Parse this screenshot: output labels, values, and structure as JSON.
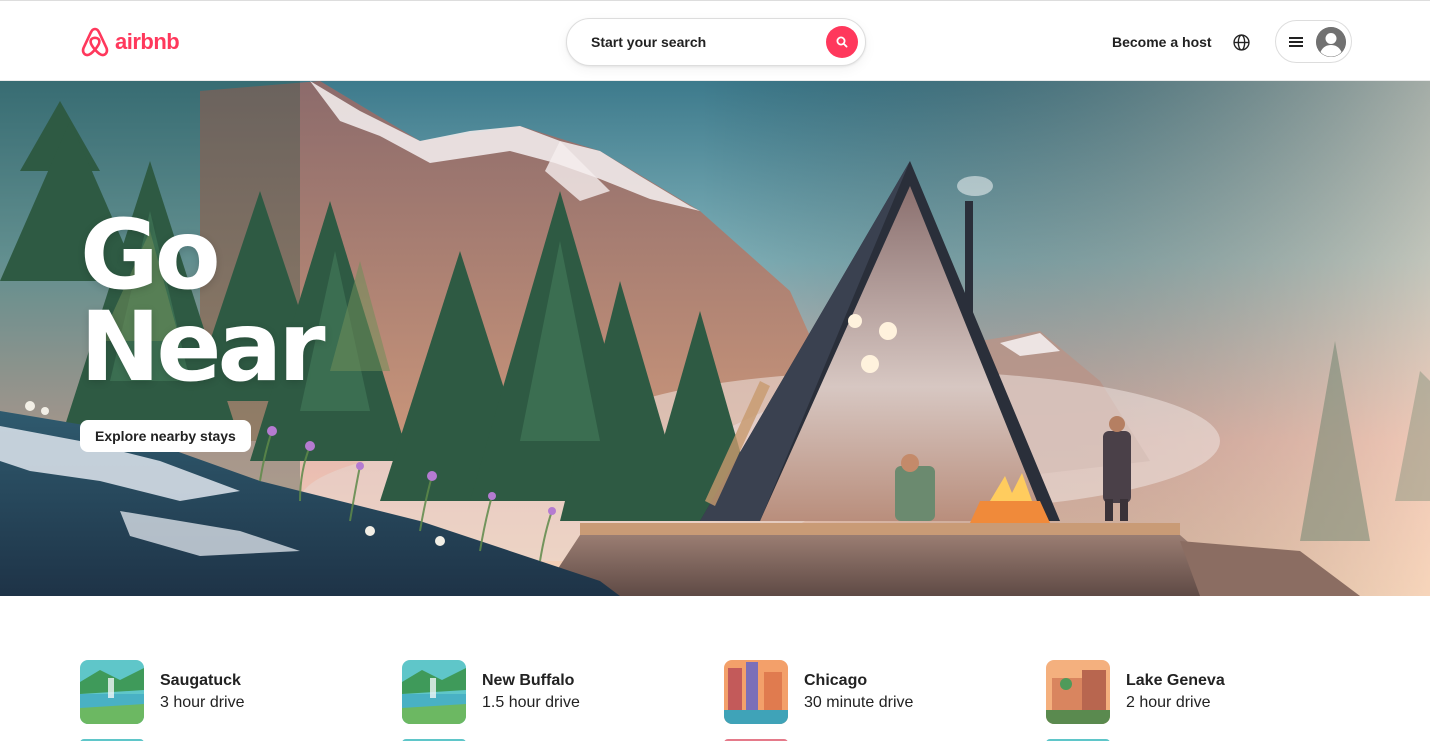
{
  "header": {
    "logo_text": "airbnb",
    "search_placeholder": "Start your search",
    "become_host": "Become a host"
  },
  "hero": {
    "title_line1": "Go",
    "title_line2": "Near",
    "cta": "Explore nearby stays"
  },
  "destinations": [
    {
      "name": "Saugatuck",
      "drive": "3 hour drive"
    },
    {
      "name": "New Buffalo",
      "drive": "1.5 hour drive"
    },
    {
      "name": "Chicago",
      "drive": "30 minute drive"
    },
    {
      "name": "Lake Geneva",
      "drive": "2 hour drive"
    }
  ],
  "colors": {
    "brand": "#FF385C",
    "text": "#222222",
    "border": "#DDDDDD"
  },
  "icons": [
    "airbnb-logo-icon",
    "search-icon",
    "globe-icon",
    "hamburger-menu-icon",
    "user-avatar-icon"
  ]
}
